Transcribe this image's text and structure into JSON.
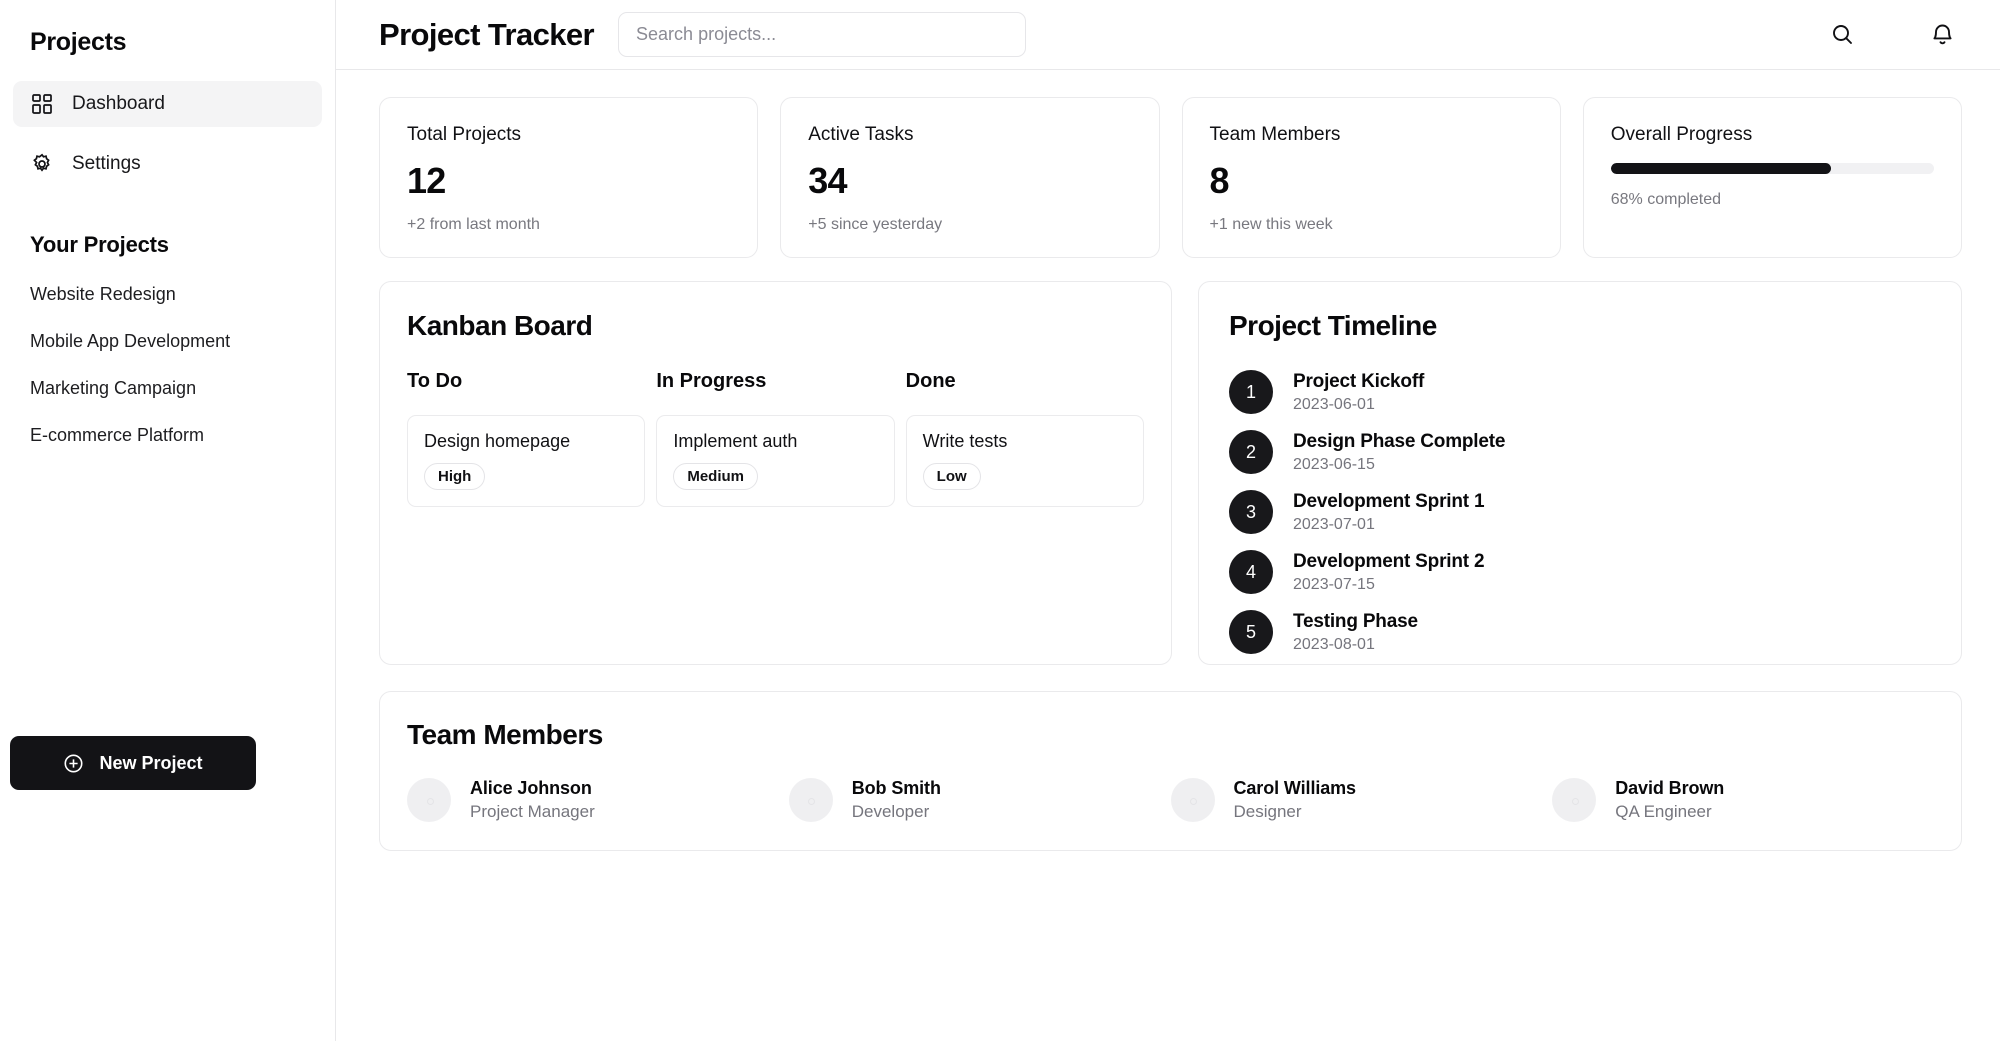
{
  "sidebar": {
    "title": "Projects",
    "nav": [
      {
        "label": "Dashboard",
        "icon": "grid-icon",
        "active": true
      },
      {
        "label": "Settings",
        "icon": "gear-icon",
        "active": false
      }
    ],
    "projects_heading": "Your Projects",
    "projects": [
      {
        "label": "Website Redesign"
      },
      {
        "label": "Mobile App Development"
      },
      {
        "label": "Marketing Campaign"
      },
      {
        "label": "E-commerce Platform"
      }
    ],
    "new_project_label": "New Project",
    "new_project_icon": "plus-circle-icon"
  },
  "topbar": {
    "title": "Project Tracker",
    "search": {
      "value": "",
      "placeholder": "Search projects..."
    },
    "search_icon": "search-icon",
    "bell_icon": "bell-icon"
  },
  "stats": [
    {
      "label": "Total Projects",
      "value": "12",
      "sub": "+2 from last month"
    },
    {
      "label": "Active Tasks",
      "value": "34",
      "sub": "+5 since yesterday"
    },
    {
      "label": "Team Members",
      "value": "8",
      "sub": "+1 new this week"
    }
  ],
  "progress": {
    "label": "Overall Progress",
    "percent": 68,
    "percent_css": "68%",
    "caption": "68% completed",
    "fill_color": "#131316",
    "track_color": "#f1f1f3"
  },
  "kanban": {
    "heading": "Kanban Board",
    "columns": [
      {
        "title": "To Do",
        "tasks": [
          {
            "title": "Design homepage",
            "priority": "High"
          }
        ]
      },
      {
        "title": "In Progress",
        "tasks": [
          {
            "title": "Implement auth",
            "priority": "Medium"
          }
        ]
      },
      {
        "title": "Done",
        "tasks": [
          {
            "title": "Write tests",
            "priority": "Low"
          }
        ]
      }
    ]
  },
  "timeline": {
    "heading": "Project Timeline",
    "items": [
      {
        "num": "1",
        "title": "Project Kickoff",
        "date": "2023-06-01"
      },
      {
        "num": "2",
        "title": "Design Phase Complete",
        "date": "2023-06-15"
      },
      {
        "num": "3",
        "title": "Development Sprint 1",
        "date": "2023-07-01"
      },
      {
        "num": "4",
        "title": "Development Sprint 2",
        "date": "2023-07-15"
      },
      {
        "num": "5",
        "title": "Testing Phase",
        "date": "2023-08-01"
      }
    ]
  },
  "team": {
    "heading": "Team Members",
    "members": [
      {
        "name": "Alice Johnson",
        "role": "Project Manager"
      },
      {
        "name": "Bob Smith",
        "role": "Developer"
      },
      {
        "name": "Carol Williams",
        "role": "Designer"
      },
      {
        "name": "David Brown",
        "role": "QA Engineer"
      }
    ]
  },
  "colors": {
    "accent": "#131316",
    "border": "#eaeaec",
    "muted": "#75757d",
    "active_bg": "#f4f4f5"
  }
}
